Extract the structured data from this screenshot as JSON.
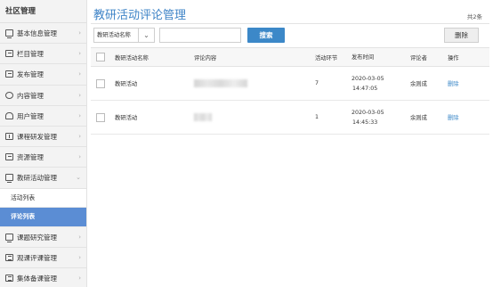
{
  "sidebar": {
    "title": "社区管理",
    "items": [
      {
        "label": "基本信息管理",
        "icon": "monitor-icon"
      },
      {
        "label": "栏目管理",
        "icon": "list-icon"
      },
      {
        "label": "发布管理",
        "icon": "list-icon"
      },
      {
        "label": "内容管理",
        "icon": "chat-icon"
      },
      {
        "label": "用户管理",
        "icon": "user-icon"
      },
      {
        "label": "课程研发管理",
        "icon": "upload-icon"
      },
      {
        "label": "资源管理",
        "icon": "list-icon"
      },
      {
        "label": "教研活动管理",
        "icon": "monitor-icon",
        "expanded": true
      }
    ],
    "subitems": [
      {
        "label": "活动列表",
        "active": false
      },
      {
        "label": "评论列表",
        "active": true
      }
    ],
    "items_after": [
      {
        "label": "课题研究管理",
        "icon": "monitor-icon"
      },
      {
        "label": "观课评课管理",
        "icon": "list-icon"
      },
      {
        "label": "集体备课管理",
        "icon": "list-icon"
      }
    ],
    "chevron": "›",
    "chevron_down": "⌄"
  },
  "main": {
    "title": "教研活动评论管理",
    "total": "共2条",
    "filter": {
      "selected": "教研活动名称",
      "arrow": "⌄",
      "input_value": ""
    },
    "search_label": "搜索",
    "delete_label": "删除",
    "columns": [
      "教研活动名称",
      "评论内容",
      "活动环节",
      "发布时间",
      "评论者",
      "操作"
    ],
    "rows": [
      {
        "name": "教研活动",
        "step": "7",
        "date": "2020-03-05",
        "time": "14:47:05",
        "author": "余则成",
        "op": "删除"
      },
      {
        "name": "教研活动",
        "step": "1",
        "date": "2020-03-05",
        "time": "14:45:33",
        "author": "余则成",
        "op": "删除"
      }
    ]
  },
  "colors": {
    "accent": "#3c88c8",
    "active_bg": "#5b8dd4",
    "title": "#3f84c7"
  }
}
